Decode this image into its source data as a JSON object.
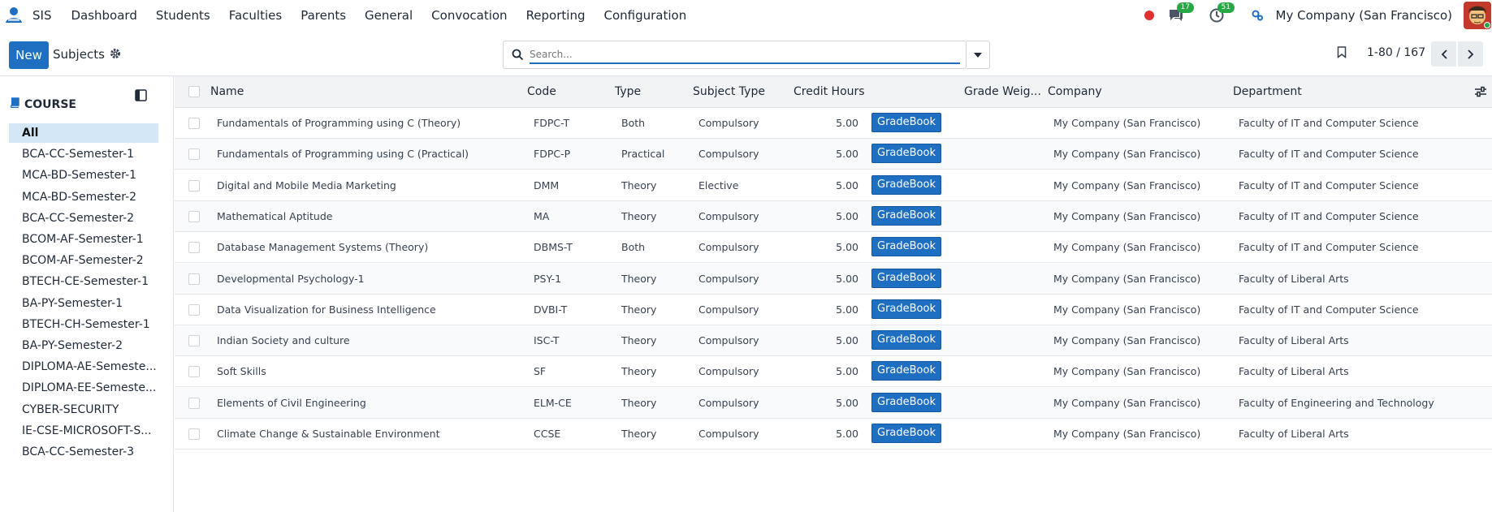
{
  "navbar": {
    "app_name": "SIS",
    "menu": [
      "Dashboard",
      "Students",
      "Faculties",
      "Parents",
      "General",
      "Convocation",
      "Reporting",
      "Configuration"
    ],
    "messages_badge": "17",
    "activities_badge": "51",
    "company": "My Company (San Francisco)"
  },
  "control": {
    "new_label": "New",
    "breadcrumb": "Subjects",
    "search_placeholder": "Search...",
    "pager": "1-80 / 167"
  },
  "sidebar": {
    "header": "COURSE",
    "items": [
      "All",
      "BCA-CC-Semester-1",
      "MCA-BD-Semester-1",
      "MCA-BD-Semester-2",
      "BCA-CC-Semester-2",
      "BCOM-AF-Semester-1",
      "BCOM-AF-Semester-2",
      "BTECH-CE-Semester-1",
      "BA-PY-Semester-1",
      "BTECH-CH-Semester-1",
      "BA-PY-Semester-2",
      "DIPLOMA-AE-Semeste...",
      "DIPLOMA-EE-Semeste...",
      "CYBER-SECURITY",
      "IE-CSE-MICROSOFT-S...",
      "BCA-CC-Semester-3"
    ]
  },
  "table": {
    "columns": {
      "name": "Name",
      "code": "Code",
      "type": "Type",
      "subject_type": "Subject Type",
      "credit_hours": "Credit Hours",
      "grade_weight": "Grade Weig...",
      "company": "Company",
      "department": "Department"
    },
    "gradebook_label": "GradeBook",
    "rows": [
      {
        "name": "Fundamentals of Programming using C (Theory)",
        "code": "FDPC-T",
        "type": "Both",
        "subject_type": "Compulsory",
        "credit": "5.00",
        "company": "My Company (San Francisco)",
        "department": "Faculty of IT and Computer Science"
      },
      {
        "name": "Fundamentals of Programming using C (Practical)",
        "code": "FDPC-P",
        "type": "Practical",
        "subject_type": "Compulsory",
        "credit": "5.00",
        "company": "My Company (San Francisco)",
        "department": "Faculty of IT and Computer Science"
      },
      {
        "name": "Digital and Mobile Media Marketing",
        "code": "DMM",
        "type": "Theory",
        "subject_type": "Elective",
        "credit": "5.00",
        "company": "My Company (San Francisco)",
        "department": "Faculty of IT and Computer Science"
      },
      {
        "name": "Mathematical Aptitude",
        "code": "MA",
        "type": "Theory",
        "subject_type": "Compulsory",
        "credit": "5.00",
        "company": "My Company (San Francisco)",
        "department": "Faculty of IT and Computer Science"
      },
      {
        "name": "Database Management Systems (Theory)",
        "code": "DBMS-T",
        "type": "Both",
        "subject_type": "Compulsory",
        "credit": "5.00",
        "company": "My Company (San Francisco)",
        "department": "Faculty of IT and Computer Science"
      },
      {
        "name": "Developmental Psychology-1",
        "code": "PSY-1",
        "type": "Theory",
        "subject_type": "Compulsory",
        "credit": "5.00",
        "company": "My Company (San Francisco)",
        "department": "Faculty of Liberal Arts"
      },
      {
        "name": "Data Visualization for Business Intelligence",
        "code": "DVBI-T",
        "type": "Theory",
        "subject_type": "Compulsory",
        "credit": "5.00",
        "company": "My Company (San Francisco)",
        "department": "Faculty of IT and Computer Science"
      },
      {
        "name": "Indian Society and culture",
        "code": "ISC-T",
        "type": "Theory",
        "subject_type": "Compulsory",
        "credit": "5.00",
        "company": "My Company (San Francisco)",
        "department": "Faculty of Liberal Arts"
      },
      {
        "name": "Soft Skills",
        "code": "SF",
        "type": "Theory",
        "subject_type": "Compulsory",
        "credit": "5.00",
        "company": "My Company (San Francisco)",
        "department": "Faculty of Liberal Arts"
      },
      {
        "name": "Elements of Civil Engineering",
        "code": "ELM-CE",
        "type": "Theory",
        "subject_type": "Compulsory",
        "credit": "5.00",
        "company": "My Company (San Francisco)",
        "department": "Faculty of Engineering and Technology"
      },
      {
        "name": "Climate Change & Sustainable Environment",
        "code": "CCSE",
        "type": "Theory",
        "subject_type": "Compulsory",
        "credit": "5.00",
        "company": "My Company (San Francisco)",
        "department": "Faculty of Liberal Arts"
      }
    ]
  },
  "colors": {
    "primary": "#1e6fc1",
    "sidebar_active": "#d3e7f7",
    "badge_green": "#28a745",
    "record_red": "#e03131"
  }
}
